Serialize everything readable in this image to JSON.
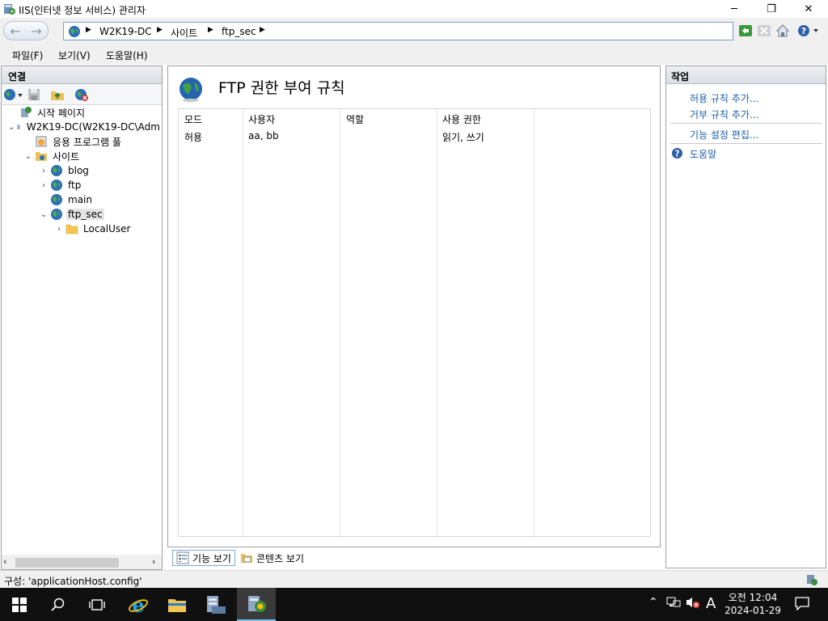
{
  "window": {
    "title": "IIS(인터넷 정보 서비스) 관리자",
    "minimize_glyph": "─",
    "restore_glyph": "❐",
    "close_glyph": "✕"
  },
  "address": {
    "crumbs": [
      "W2K19-DC",
      "사이트",
      "ftp_sec"
    ]
  },
  "menu": {
    "items": [
      "파일(F)",
      "보기(V)",
      "도움말(H)"
    ]
  },
  "connections": {
    "title": "연결",
    "tree": [
      {
        "label": "시작 페이지",
        "icon": "start-page-icon",
        "expander": "",
        "indent": 0
      },
      {
        "label": "W2K19-DC(W2K19-DC\\Adm",
        "icon": "server-icon",
        "expander": "⌄",
        "indent": 0
      },
      {
        "label": "응용 프로그램 풀",
        "icon": "app-pool-icon",
        "expander": "",
        "indent": 1
      },
      {
        "label": "사이트",
        "icon": "sites-folder-icon",
        "expander": "⌄",
        "indent": 1
      },
      {
        "label": "blog",
        "icon": "globe-icon",
        "expander": "›",
        "indent": 2
      },
      {
        "label": "ftp",
        "icon": "globe-icon",
        "expander": "›",
        "indent": 2
      },
      {
        "label": "main",
        "icon": "globe-icon",
        "expander": "",
        "indent": 2
      },
      {
        "label": "ftp_sec",
        "icon": "globe-icon",
        "expander": "⌄",
        "indent": 2,
        "selected": true
      },
      {
        "label": "LocalUser",
        "icon": "folder-icon",
        "expander": "›",
        "indent": 3
      }
    ]
  },
  "main": {
    "title": "FTP 권한 부여 규칙",
    "columns": [
      "모드",
      "사용자",
      "역할",
      "사용 권한",
      ""
    ],
    "rows": [
      [
        "허용",
        "aa, bb",
        "",
        "읽기, 쓰기",
        ""
      ]
    ],
    "view_tabs": [
      "기능 보기",
      "콘텐츠 보기"
    ]
  },
  "actions": {
    "title": "작업",
    "links": [
      "허용 규칙 추가...",
      "거부 규칙 추가...",
      "기능 설정 편집...",
      "도움말"
    ]
  },
  "status": {
    "text": "구성: 'applicationHost.config'"
  },
  "taskbar": {
    "time": "오전 12:04",
    "date": "2024-01-29",
    "ime": "A"
  },
  "colors": {
    "link": "#1a5ea8",
    "taskbar": "#101010",
    "accent": "#76b9ed"
  }
}
